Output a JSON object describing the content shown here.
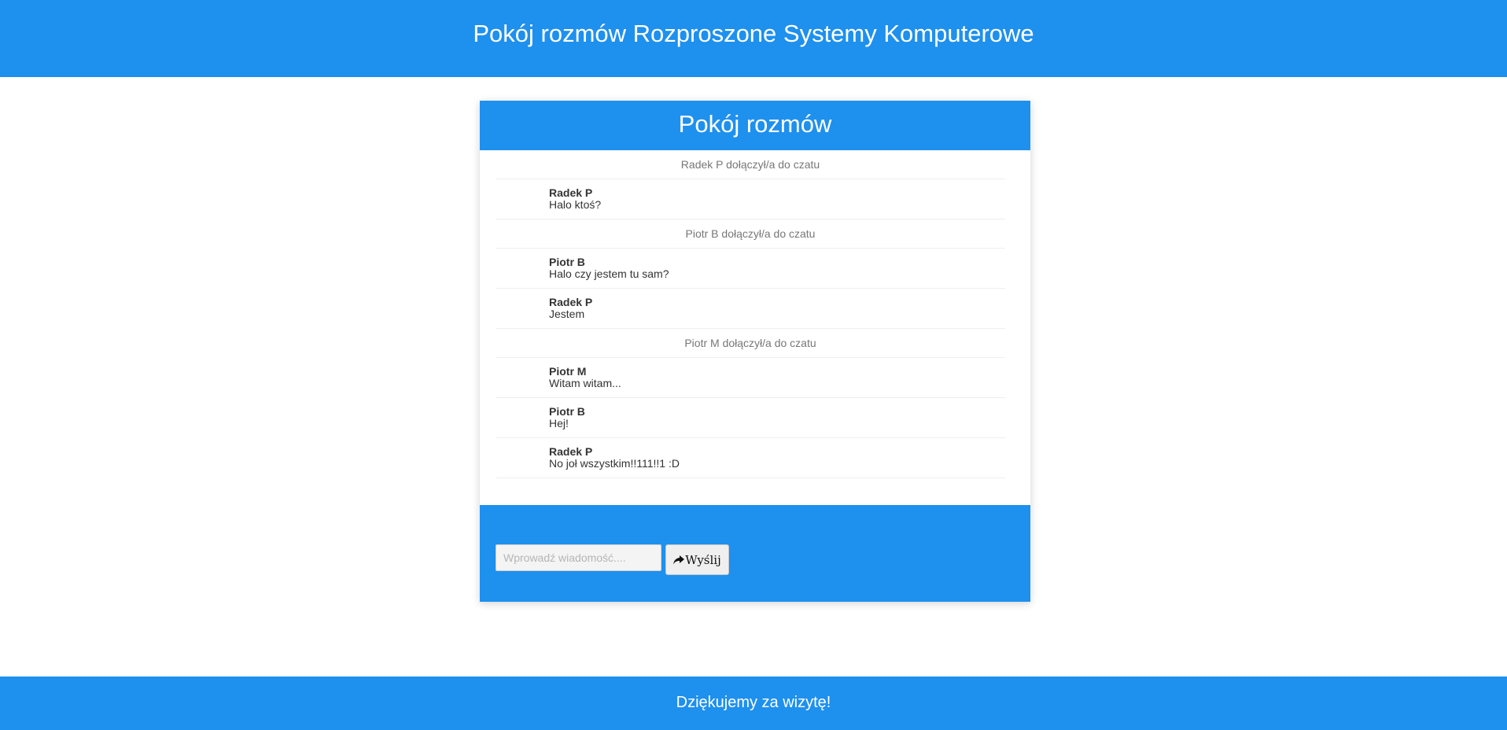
{
  "header": {
    "title": "Pokój rozmów Rozproszone Systemy Komputerowe"
  },
  "chat": {
    "title": "Pokój rozmów",
    "messages": [
      {
        "type": "system",
        "text": "Radek P dołączył/a do czatu"
      },
      {
        "type": "user",
        "author": "Radek P",
        "text": "Halo ktoś?"
      },
      {
        "type": "system",
        "text": "Piotr B dołączył/a do czatu"
      },
      {
        "type": "user",
        "author": "Piotr B",
        "text": "Halo czy jestem tu sam?"
      },
      {
        "type": "user",
        "author": "Radek P",
        "text": "Jestem"
      },
      {
        "type": "system",
        "text": "Piotr M dołączył/a do czatu"
      },
      {
        "type": "user",
        "author": "Piotr M",
        "text": "Witam witam..."
      },
      {
        "type": "user",
        "author": "Piotr B",
        "text": "Hej!"
      },
      {
        "type": "user",
        "author": "Radek P",
        "text": "No joł wszystkim!!111!!1 :D"
      }
    ],
    "input": {
      "placeholder": "Wprowadź wiadomość....",
      "value": ""
    },
    "send_button": {
      "label": "Wyślij",
      "icon": "share-arrow-icon"
    }
  },
  "footer": {
    "text": "Dziękujemy za wizytę!"
  },
  "colors": {
    "brand": "#1e90ee",
    "background": "#ffffff"
  }
}
